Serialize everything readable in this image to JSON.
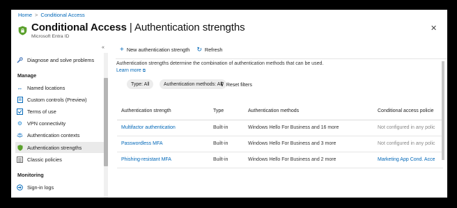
{
  "breadcrumb": {
    "home": "Home",
    "separator": ">",
    "current": "Conditional Access"
  },
  "header": {
    "title_main": "Conditional Access",
    "title_sep": "|",
    "title_sub": "Authentication strengths",
    "subtitle": "Microsoft Entra ID",
    "more": "···",
    "close": "✕"
  },
  "sidebar": {
    "collapse": "«",
    "top_item": {
      "label": "Diagnose and solve problems",
      "icon": "wrench-icon"
    },
    "sections": [
      {
        "title": "Manage"
      },
      {
        "title": "Monitoring"
      }
    ],
    "manage_items": [
      {
        "label": "Named locations",
        "icon": "arrows-icon"
      },
      {
        "label": "Custom controls (Preview)",
        "icon": "document-icon"
      },
      {
        "label": "Terms of use",
        "icon": "checkbox-icon"
      },
      {
        "label": "VPN connectivity",
        "icon": "gear-icon"
      },
      {
        "label": "Authentication contexts",
        "icon": "layers-icon"
      },
      {
        "label": "Authentication strengths",
        "icon": "shield-icon",
        "active": true
      },
      {
        "label": "Classic policies",
        "icon": "list-icon"
      }
    ],
    "monitoring_items": [
      {
        "label": "Sign-in logs",
        "icon": "log-icon"
      }
    ]
  },
  "toolbar": {
    "new_label": "New authentication strength",
    "refresh_label": "Refresh"
  },
  "description": "Authentication strengths determine the combination of authentication methods that can be used.",
  "learn_more": "Learn more",
  "filters": {
    "type": "Type: All",
    "methods": "Authentication methods: All",
    "reset": "Reset filters"
  },
  "table": {
    "headers": [
      "Authentication strength",
      "Type",
      "Authentication methods",
      "Conditional access policie"
    ],
    "rows": [
      {
        "name": "Multifactor authentication",
        "type": "Built-in",
        "methods": "Windows Hello For Business and 16 more",
        "policies": "Not configured in any polic",
        "policies_link": false
      },
      {
        "name": "Passwordless MFA",
        "type": "Built-in",
        "methods": "Windows Hello For Business and 3 more",
        "policies": "Not configured in any polic",
        "policies_link": false
      },
      {
        "name": "Phishing-resistant MFA",
        "type": "Built-in",
        "methods": "Windows Hello For Business and 2 more",
        "policies": "Marketing App Cond. Acce",
        "policies_link": true
      }
    ]
  },
  "colors": {
    "accent": "#0067b8",
    "shield": "#5aa02c"
  }
}
